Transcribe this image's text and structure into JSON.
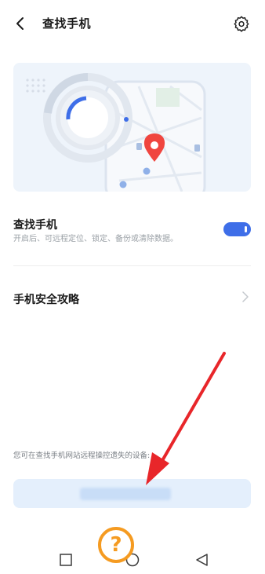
{
  "header": {
    "title": "查找手机",
    "back_icon": "chevron-left-icon",
    "settings_icon": "gear-icon"
  },
  "find_phone": {
    "title": "查找手机",
    "subtitle": "开启后、可远程定位、锁定、备份或清除数据。",
    "enabled": true
  },
  "security_guide": {
    "title": "手机安全攻略",
    "icon": "chevron-right-icon"
  },
  "remote_hint": "您可在查找手机网站远程操控遗失的设备:",
  "annotation": {
    "help_symbol": "?"
  },
  "colors": {
    "accent": "#3e6ee8",
    "pin_red": "#f0453f",
    "annotation_red": "#e8262a",
    "help_orange": "#f59b21"
  },
  "nav": {
    "recent_icon": "square-icon",
    "home_icon": "circle-icon",
    "back_icon": "triangle-back-icon"
  }
}
